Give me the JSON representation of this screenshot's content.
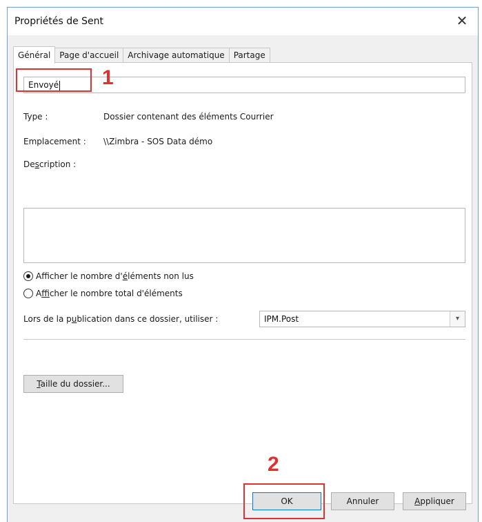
{
  "window": {
    "title": "Propriétés de Sent",
    "close_glyph": "✕"
  },
  "tabs": [
    {
      "label": "Général",
      "active": true
    },
    {
      "label": "Page d'accueil",
      "active": false
    },
    {
      "label": "Archivage automatique",
      "active": false
    },
    {
      "label": "Partage",
      "active": false
    }
  ],
  "general": {
    "folder_name_value": "Envoyé",
    "type_label": "Type :",
    "type_value": "Dossier contenant des éléments Courrier",
    "location_label": "Emplacement :",
    "location_value": "\\\\Zimbra - SOS Data démo",
    "description_label_pre": "De",
    "description_label_u": "s",
    "description_label_post": "cription :",
    "description_value": "",
    "radio_unread_pre": "Afficher le nombre d'",
    "radio_unread_u": "é",
    "radio_unread_post": "léments non lus",
    "radio_total_pre": "A",
    "radio_total_u": "f",
    "radio_total_post": "ficher le nombre total d'éléments",
    "post_label_pre": "Lors de la p",
    "post_label_u": "u",
    "post_label_post": "blication dans ce dossier, utiliser :",
    "post_value": "IPM.Post",
    "size_button_u": "T",
    "size_button_rest": "aille du dossier..."
  },
  "buttons": {
    "ok": "OK",
    "cancel": "Annuler",
    "apply_u": "A",
    "apply_rest": "ppliquer"
  },
  "annotations": {
    "step1": "1",
    "step2": "2",
    "highlight_color": "#e03030"
  }
}
